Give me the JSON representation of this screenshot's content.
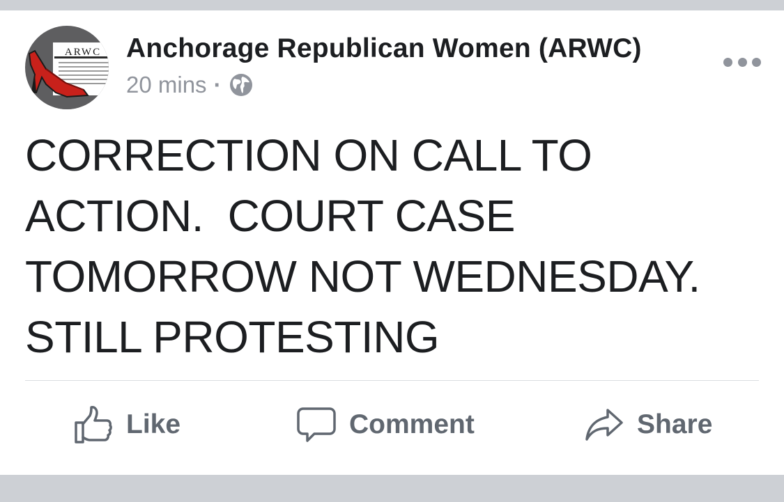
{
  "post": {
    "author": "Anchorage Republican Women (ARWC)",
    "avatar_text": "ARWC",
    "time": "20 mins",
    "separator": "·",
    "privacy_icon": "globe-icon",
    "text": "CORRECTION ON CALL TO\nACTION.  COURT CASE\nTOMORROW NOT WEDNESDAY.\nSTILL PROTESTING"
  },
  "actions": {
    "like": {
      "label": "Like",
      "icon": "thumbs-up-icon"
    },
    "comment": {
      "label": "Comment",
      "icon": "speech-bubble-icon"
    },
    "share": {
      "label": "Share",
      "icon": "share-arrow-icon"
    }
  },
  "more_icon": "ellipsis-icon",
  "colors": {
    "background_band": "#cdd0d5",
    "text_primary": "#1c1e21",
    "text_secondary": "#90949c",
    "action_text": "#606770",
    "shoe_red": "#c8211b"
  }
}
